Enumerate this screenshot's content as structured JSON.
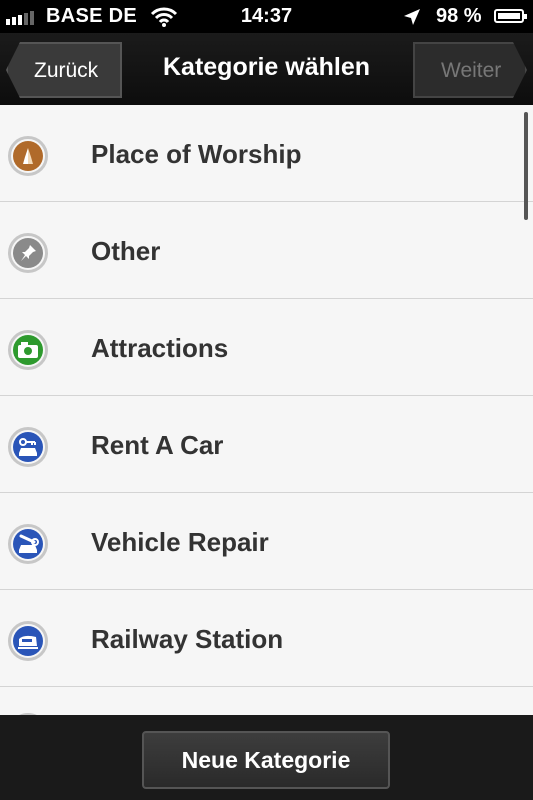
{
  "status_bar": {
    "carrier": "BASE DE",
    "time": "14:37",
    "battery_text": "98 %",
    "battery_level": 0.98
  },
  "nav": {
    "back_label": "Zurück",
    "title": "Kategorie wählen",
    "next_label": "Weiter"
  },
  "categories": [
    {
      "label": "Place of Worship",
      "icon": "praying-hands-icon",
      "color": "#b06a2a"
    },
    {
      "label": "Other",
      "icon": "pin-icon",
      "color": "#8a8a8a"
    },
    {
      "label": "Attractions",
      "icon": "camera-icon",
      "color": "#2e9a2e"
    },
    {
      "label": "Rent A Car",
      "icon": "car-key-icon",
      "color": "#2a55b8"
    },
    {
      "label": "Vehicle Repair",
      "icon": "car-wrench-icon",
      "color": "#2a55b8"
    },
    {
      "label": "Railway Station",
      "icon": "train-icon",
      "color": "#2a55b8"
    }
  ],
  "bottom": {
    "new_category_label": "Neue Kategorie"
  }
}
